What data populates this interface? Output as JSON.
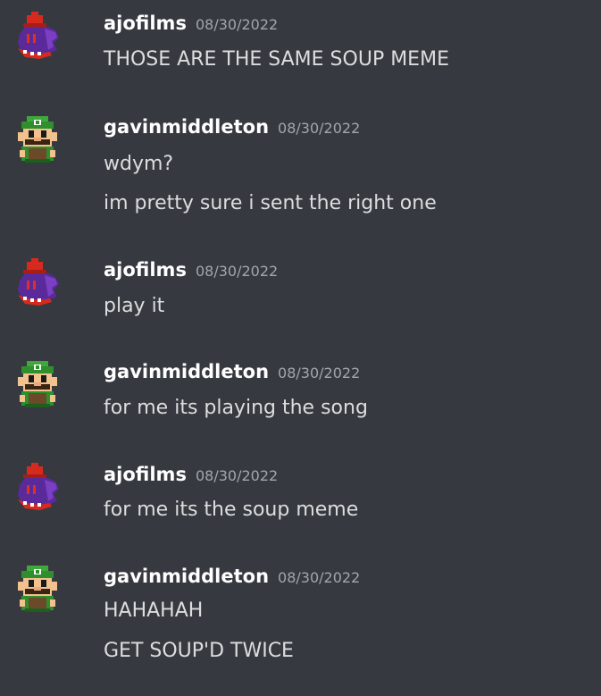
{
  "colors": {
    "background": "#36393f",
    "username": "#ffffff",
    "timestamp": "#a3a6aa",
    "message_text": "#dcddde"
  },
  "messages": [
    {
      "author": "ajofilms",
      "avatar_icon": "purple-hat-creature-avatar",
      "timestamp": "08/30/2022",
      "lines": [
        "THOSE ARE THE SAME SOUP MEME"
      ]
    },
    {
      "author": "gavinmiddleton",
      "avatar_icon": "pixel-luigi-avatar",
      "timestamp": "08/30/2022",
      "lines": [
        "wdym?",
        "im pretty sure i sent the right one"
      ]
    },
    {
      "author": "ajofilms",
      "avatar_icon": "purple-hat-creature-avatar",
      "timestamp": "08/30/2022",
      "lines": [
        "play it"
      ]
    },
    {
      "author": "gavinmiddleton",
      "avatar_icon": "pixel-luigi-avatar",
      "timestamp": "08/30/2022",
      "lines": [
        "for me its playing the song"
      ]
    },
    {
      "author": "ajofilms",
      "avatar_icon": "purple-hat-creature-avatar",
      "timestamp": "08/30/2022",
      "lines": [
        "for me its the soup meme"
      ]
    },
    {
      "author": "gavinmiddleton",
      "avatar_icon": "pixel-luigi-avatar",
      "timestamp": "08/30/2022",
      "lines": [
        "HAHAHAH",
        "GET SOUP'D TWICE"
      ]
    }
  ]
}
